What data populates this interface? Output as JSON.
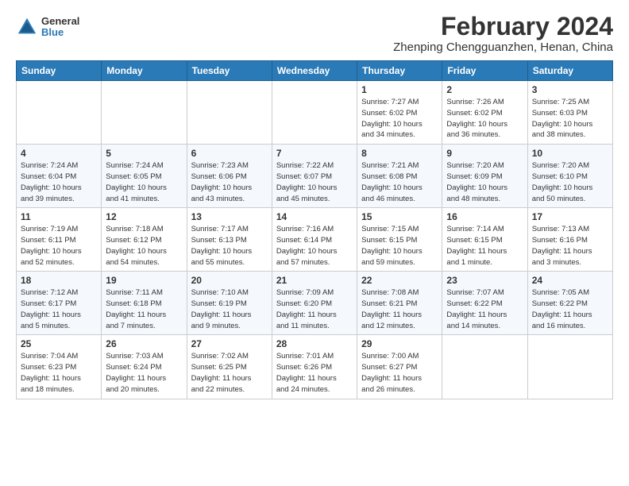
{
  "header": {
    "logo_general": "General",
    "logo_blue": "Blue",
    "month_year": "February 2024",
    "location": "Zhenping Chengguanzhen, Henan, China"
  },
  "weekdays": [
    "Sunday",
    "Monday",
    "Tuesday",
    "Wednesday",
    "Thursday",
    "Friday",
    "Saturday"
  ],
  "weeks": [
    [
      {
        "day": "",
        "info": ""
      },
      {
        "day": "",
        "info": ""
      },
      {
        "day": "",
        "info": ""
      },
      {
        "day": "",
        "info": ""
      },
      {
        "day": "1",
        "info": "Sunrise: 7:27 AM\nSunset: 6:02 PM\nDaylight: 10 hours\nand 34 minutes."
      },
      {
        "day": "2",
        "info": "Sunrise: 7:26 AM\nSunset: 6:02 PM\nDaylight: 10 hours\nand 36 minutes."
      },
      {
        "day": "3",
        "info": "Sunrise: 7:25 AM\nSunset: 6:03 PM\nDaylight: 10 hours\nand 38 minutes."
      }
    ],
    [
      {
        "day": "4",
        "info": "Sunrise: 7:24 AM\nSunset: 6:04 PM\nDaylight: 10 hours\nand 39 minutes."
      },
      {
        "day": "5",
        "info": "Sunrise: 7:24 AM\nSunset: 6:05 PM\nDaylight: 10 hours\nand 41 minutes."
      },
      {
        "day": "6",
        "info": "Sunrise: 7:23 AM\nSunset: 6:06 PM\nDaylight: 10 hours\nand 43 minutes."
      },
      {
        "day": "7",
        "info": "Sunrise: 7:22 AM\nSunset: 6:07 PM\nDaylight: 10 hours\nand 45 minutes."
      },
      {
        "day": "8",
        "info": "Sunrise: 7:21 AM\nSunset: 6:08 PM\nDaylight: 10 hours\nand 46 minutes."
      },
      {
        "day": "9",
        "info": "Sunrise: 7:20 AM\nSunset: 6:09 PM\nDaylight: 10 hours\nand 48 minutes."
      },
      {
        "day": "10",
        "info": "Sunrise: 7:20 AM\nSunset: 6:10 PM\nDaylight: 10 hours\nand 50 minutes."
      }
    ],
    [
      {
        "day": "11",
        "info": "Sunrise: 7:19 AM\nSunset: 6:11 PM\nDaylight: 10 hours\nand 52 minutes."
      },
      {
        "day": "12",
        "info": "Sunrise: 7:18 AM\nSunset: 6:12 PM\nDaylight: 10 hours\nand 54 minutes."
      },
      {
        "day": "13",
        "info": "Sunrise: 7:17 AM\nSunset: 6:13 PM\nDaylight: 10 hours\nand 55 minutes."
      },
      {
        "day": "14",
        "info": "Sunrise: 7:16 AM\nSunset: 6:14 PM\nDaylight: 10 hours\nand 57 minutes."
      },
      {
        "day": "15",
        "info": "Sunrise: 7:15 AM\nSunset: 6:15 PM\nDaylight: 10 hours\nand 59 minutes."
      },
      {
        "day": "16",
        "info": "Sunrise: 7:14 AM\nSunset: 6:15 PM\nDaylight: 11 hours\nand 1 minute."
      },
      {
        "day": "17",
        "info": "Sunrise: 7:13 AM\nSunset: 6:16 PM\nDaylight: 11 hours\nand 3 minutes."
      }
    ],
    [
      {
        "day": "18",
        "info": "Sunrise: 7:12 AM\nSunset: 6:17 PM\nDaylight: 11 hours\nand 5 minutes."
      },
      {
        "day": "19",
        "info": "Sunrise: 7:11 AM\nSunset: 6:18 PM\nDaylight: 11 hours\nand 7 minutes."
      },
      {
        "day": "20",
        "info": "Sunrise: 7:10 AM\nSunset: 6:19 PM\nDaylight: 11 hours\nand 9 minutes."
      },
      {
        "day": "21",
        "info": "Sunrise: 7:09 AM\nSunset: 6:20 PM\nDaylight: 11 hours\nand 11 minutes."
      },
      {
        "day": "22",
        "info": "Sunrise: 7:08 AM\nSunset: 6:21 PM\nDaylight: 11 hours\nand 12 minutes."
      },
      {
        "day": "23",
        "info": "Sunrise: 7:07 AM\nSunset: 6:22 PM\nDaylight: 11 hours\nand 14 minutes."
      },
      {
        "day": "24",
        "info": "Sunrise: 7:05 AM\nSunset: 6:22 PM\nDaylight: 11 hours\nand 16 minutes."
      }
    ],
    [
      {
        "day": "25",
        "info": "Sunrise: 7:04 AM\nSunset: 6:23 PM\nDaylight: 11 hours\nand 18 minutes."
      },
      {
        "day": "26",
        "info": "Sunrise: 7:03 AM\nSunset: 6:24 PM\nDaylight: 11 hours\nand 20 minutes."
      },
      {
        "day": "27",
        "info": "Sunrise: 7:02 AM\nSunset: 6:25 PM\nDaylight: 11 hours\nand 22 minutes."
      },
      {
        "day": "28",
        "info": "Sunrise: 7:01 AM\nSunset: 6:26 PM\nDaylight: 11 hours\nand 24 minutes."
      },
      {
        "day": "29",
        "info": "Sunrise: 7:00 AM\nSunset: 6:27 PM\nDaylight: 11 hours\nand 26 minutes."
      },
      {
        "day": "",
        "info": ""
      },
      {
        "day": "",
        "info": ""
      }
    ]
  ]
}
